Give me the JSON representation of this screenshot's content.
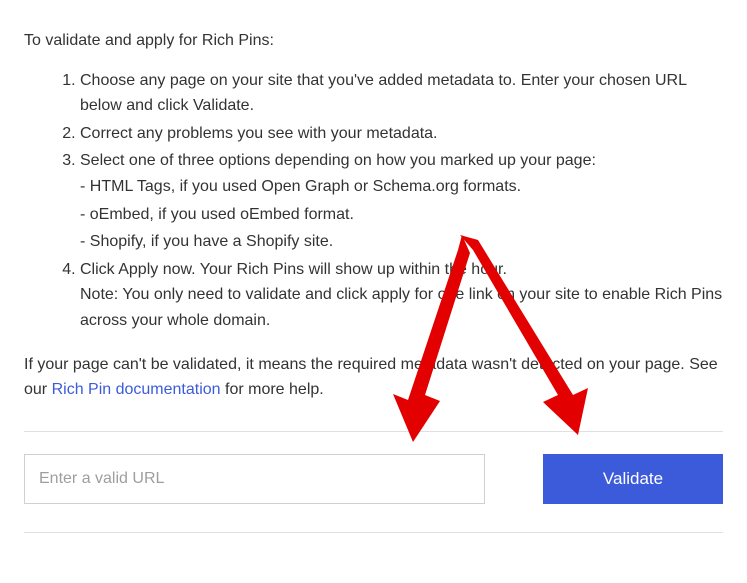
{
  "intro_text": "To validate and apply for Rich Pins:",
  "steps": {
    "s1": "Choose any page on your site that you've added metadata to. Enter your chosen URL below and click Validate.",
    "s2": "Correct any problems you see with your metadata.",
    "s3": "Select one of three options depending on how you marked up your page:",
    "s3_options": {
      "a": "HTML Tags, if you used Open Graph or Schema.org formats.",
      "b": "oEmbed, if you used oEmbed format.",
      "c": "Shopify, if you have a Shopify site."
    },
    "s4": "Click Apply now. Your Rich Pins will show up within the hour.",
    "s4_note": "Note: You only need to validate and click apply for one link on your site to enable Rich Pins across your whole domain."
  },
  "footer": {
    "before_link": "If your page can't be validated, it means the required metadata wasn't detected on your page. See our ",
    "link_text": "Rich Pin documentation",
    "after_link": " for more help."
  },
  "form": {
    "url_placeholder": "Enter a valid URL",
    "validate_label": "Validate"
  },
  "colors": {
    "accent": "#3b5bdb",
    "arrow": "#e30000"
  }
}
